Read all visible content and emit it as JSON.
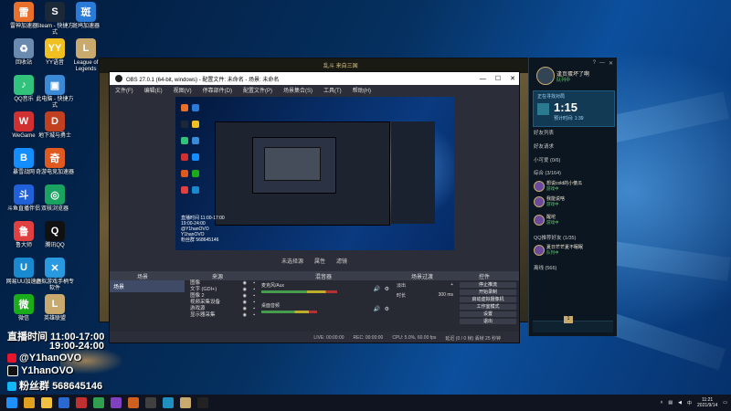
{
  "desktop": {
    "icons": [
      {
        "label": "雷神加速器",
        "color": "#e8702a",
        "glyph": "雷"
      },
      {
        "label": "Steam - 快捷方式",
        "color": "#1b2838",
        "glyph": "S"
      },
      {
        "label": "斑鸠加速器",
        "color": "#2a7ad8",
        "glyph": "斑"
      },
      {
        "label": "回收站",
        "color": "#6a8ab0",
        "glyph": "♻"
      },
      {
        "label": "YY语音",
        "color": "#f0c020",
        "glyph": "YY"
      },
      {
        "label": "League of Legends",
        "color": "#c8aa6e",
        "glyph": "L"
      },
      {
        "label": "QQ音乐",
        "color": "#31c27c",
        "glyph": "♪"
      },
      {
        "label": "此电脑 - 快捷方式",
        "color": "#3a8ad8",
        "glyph": "▣"
      },
      {
        "label": "WeGame",
        "color": "#d03030",
        "glyph": "W"
      },
      {
        "label": "地下城与勇士",
        "color": "#c04020",
        "glyph": "D"
      },
      {
        "label": "暴雪战网",
        "color": "#148eff",
        "glyph": "B"
      },
      {
        "label": "奇游电竞加速器",
        "color": "#e05a20",
        "glyph": "奇"
      },
      {
        "label": "斗鱼直播伴侣",
        "color": "#2060d8",
        "glyph": "斗"
      },
      {
        "label": "双核浏览器",
        "color": "#1aa260",
        "glyph": "◎"
      },
      {
        "label": "鲁大师",
        "color": "#e04040",
        "glyph": "鲁"
      },
      {
        "label": "腾讯QQ",
        "color": "#111111",
        "glyph": "Q"
      },
      {
        "label": "网易UU加速器",
        "color": "#1a8ad0",
        "glyph": "U"
      },
      {
        "label": "虚拟游戏手柄专软件",
        "color": "#2a9ae0",
        "glyph": "✕"
      },
      {
        "label": "微信",
        "color": "#1aad19",
        "glyph": "微"
      },
      {
        "label": "英雄联盟",
        "color": "#c8aa6e",
        "glyph": "L"
      }
    ]
  },
  "game_window": {
    "title_text": "乱斗 来自三国"
  },
  "obs": {
    "title": "OBS 27.0.1 (64-bit, windows) - 配置文件: 未命名 - 场景: 未命名",
    "menu": [
      "文件(F)",
      "编辑(E)",
      "视图(V)",
      "停靠部件(D)",
      "配置文件(P)",
      "场景集合(S)",
      "工具(T)",
      "帮助(H)"
    ],
    "preview_overlay": [
      "直播时间 11:00-17:00",
      "19:00-24:00",
      "@Y1hanOVO",
      "Y1hanOVO",
      "粉丝群 568645146"
    ],
    "below_preview": [
      "未选择源",
      "属性",
      "滤镜"
    ],
    "docks": {
      "scenes": "场景",
      "sources": "来源",
      "mixer": "混音器",
      "transitions": "场景过渡",
      "controls": "控件"
    },
    "scenes": [
      "场景"
    ],
    "sources": [
      "图像",
      "文字 (GDI+)",
      "图像 2",
      "视频采集设备",
      "游戏源",
      "显示器采集"
    ],
    "mixer": [
      {
        "name": "麦克风/Aux",
        "level": 0.75
      },
      {
        "name": "桌面音频",
        "level": 0.55
      }
    ],
    "transitions": {
      "type": "淡出",
      "duration_label": "时长",
      "duration": "300 ms"
    },
    "controls": [
      "停止推流",
      "开始录制",
      "启动虚拟摄像机",
      "工作室模式",
      "设置",
      "退出"
    ],
    "status": [
      "LIVE: 00:00:00",
      "REC: 00:00:00",
      "CPU: 5.0%, 60.00 fps",
      "延迟 (0 / 0 帧) 丢帧 25 秒钟"
    ]
  },
  "lol_client": {
    "name": "逢页蛋坏了啊",
    "status": "队列中",
    "timer_label": "正在寻找对局",
    "timer": "1:15",
    "timer_sub": "预计时间: 1:39",
    "sections": [
      "好友列表",
      "好友请求",
      "小可爱 (0/6)",
      "综合 (3/164)",
      "QQ推荐好友 (1/35)",
      "离线 (566)"
    ],
    "friends": [
      {
        "name": "想说cold的小傻瓜",
        "status": "游戏中"
      },
      {
        "name": "我能说啥",
        "status": "游戏中"
      },
      {
        "name": "醒坨",
        "status": "游戏中"
      },
      {
        "name": "夏日芒芒夏不眠眠",
        "status": "队列中"
      }
    ],
    "bottom_count": "1"
  },
  "overlay": {
    "schedule_label": "直播时间",
    "schedule_1": "11:00-17:00",
    "schedule_2": "19:00-24:00",
    "weibo": "@Y1hanOVO",
    "douyin": "Y1hanOVO",
    "fans_label": "粉丝群",
    "fans_number": "568645146"
  },
  "taskbar": {
    "apps": [
      {
        "name": "start-button",
        "color": "#1e90ff"
      },
      {
        "name": "chrome",
        "color": "#e0a020"
      },
      {
        "name": "file-explorer",
        "color": "#f0c040"
      },
      {
        "name": "app-1",
        "color": "#2a6ad0"
      },
      {
        "name": "app-2",
        "color": "#c03030"
      },
      {
        "name": "app-3",
        "color": "#30a050"
      },
      {
        "name": "app-4",
        "color": "#8040c0"
      },
      {
        "name": "app-5",
        "color": "#d06020"
      },
      {
        "name": "app-6",
        "color": "#404040"
      },
      {
        "name": "app-7",
        "color": "#2090c0"
      },
      {
        "name": "app-8",
        "color": "#c8aa6e"
      },
      {
        "name": "obs",
        "color": "#222222"
      }
    ],
    "time": "11:21",
    "date": "2021/9/14"
  }
}
